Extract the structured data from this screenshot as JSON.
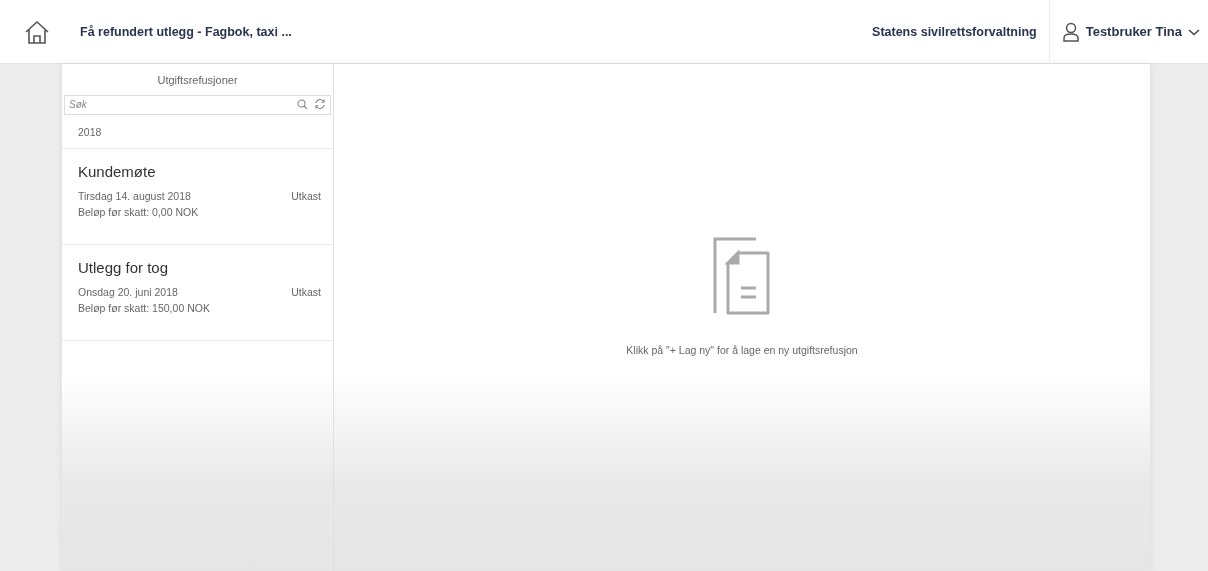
{
  "header": {
    "title": "Få refundert utlegg - Fagbok, taxi ...",
    "organization": "Statens sivilrettsforvaltning",
    "user": "Testbruker Tina"
  },
  "master": {
    "title": "Utgiftsrefusjoner",
    "search": {
      "placeholder": "Søk"
    },
    "group": "2018",
    "items": [
      {
        "title": "Kundemøte",
        "date": "Tirsdag 14. august 2018",
        "status": "Utkast",
        "amount": "Beløp før skatt: 0,00 NOK"
      },
      {
        "title": "Utlegg for tog",
        "date": "Onsdag 20. juni 2018",
        "status": "Utkast",
        "amount": "Beløp før skatt: 150,00 NOK"
      }
    ]
  },
  "detail": {
    "message": "Klikk på \"+ Lag ny\" for å lage en ny utgiftsrefusjon"
  }
}
